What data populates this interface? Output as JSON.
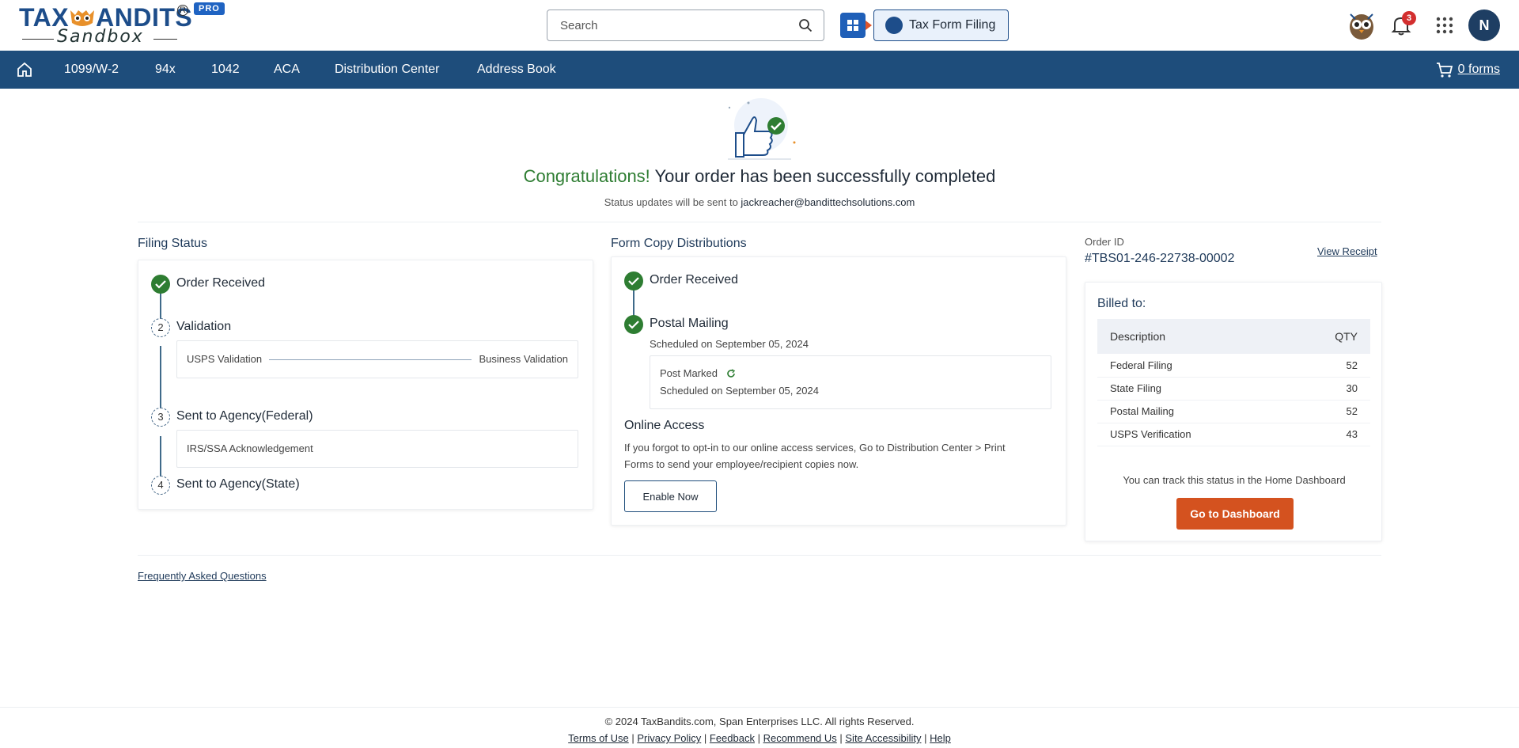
{
  "header": {
    "logo_text": "TAXBANDITS",
    "logo_sub": "Sandbox",
    "pro_badge": "PRO",
    "search_placeholder": "Search",
    "tax_form_button": "Tax Form Filing",
    "notification_count": "3",
    "user_initial": "N"
  },
  "nav": {
    "items": [
      "1099/W-2",
      "94x",
      "1042",
      "ACA",
      "Distribution Center",
      "Address Book"
    ],
    "cart_label": "0 forms"
  },
  "hero": {
    "congrats_green": "Congratulations!",
    "congrats_rest": " Your order has been successfully completed",
    "status_prefix": "Status updates will be sent to ",
    "email": "jackreacher@bandittechsolutions.com"
  },
  "filing_status": {
    "title": "Filing Status",
    "steps": [
      {
        "num": "",
        "label": "Order Received"
      },
      {
        "num": "2",
        "label": "Validation"
      },
      {
        "num": "3",
        "label": "Sent to Agency(Federal)"
      },
      {
        "num": "4",
        "label": "Sent to Agency(State)"
      }
    ],
    "validation_left": "USPS Validation",
    "validation_right": "Business Validation",
    "federal_sub": "IRS/SSA Acknowledgement"
  },
  "distributions": {
    "title": "Form Copy Distributions",
    "order_received": "Order Received",
    "postal_mailing": "Postal Mailing",
    "postal_scheduled": "Scheduled on September 05, 2024",
    "post_marked": "Post Marked",
    "post_marked_scheduled": "Scheduled on September 05, 2024",
    "online_access_title": "Online Access",
    "online_access_text_1": "If you forgot to opt-in to our online access services, Go to Distribution Center > Print",
    "online_access_text_2": "Forms to send your employee/recipient copies now.",
    "enable_button": "Enable Now"
  },
  "order": {
    "id_label": "Order ID",
    "id_value": "#TBS01-246-22738-00002",
    "view_receipt": "View Receipt",
    "billed_to": "Billed to:",
    "col_description": "Description",
    "col_qty": "QTY",
    "rows": [
      {
        "description": "Federal Filing",
        "qty": "52"
      },
      {
        "description": "State Filing",
        "qty": "30"
      },
      {
        "description": "Postal Mailing",
        "qty": "52"
      },
      {
        "description": "USPS Verification",
        "qty": "43"
      }
    ],
    "track_text": "You can track this status in the Home Dashboard",
    "dashboard_button": "Go to Dashboard"
  },
  "faq_link": "Frequently Asked Questions",
  "footer": {
    "copyright": "© 2024 TaxBandits.com, Span Enterprises LLC. All rights Reserved.",
    "links": [
      "Terms of Use",
      "Privacy Policy",
      "Feedback",
      "Recommend Us",
      "Site Accessibility",
      "Help"
    ]
  },
  "colors": {
    "nav_bg": "#1e4d7b",
    "success_green": "#2e7d32",
    "primary_orange": "#d4521f"
  }
}
